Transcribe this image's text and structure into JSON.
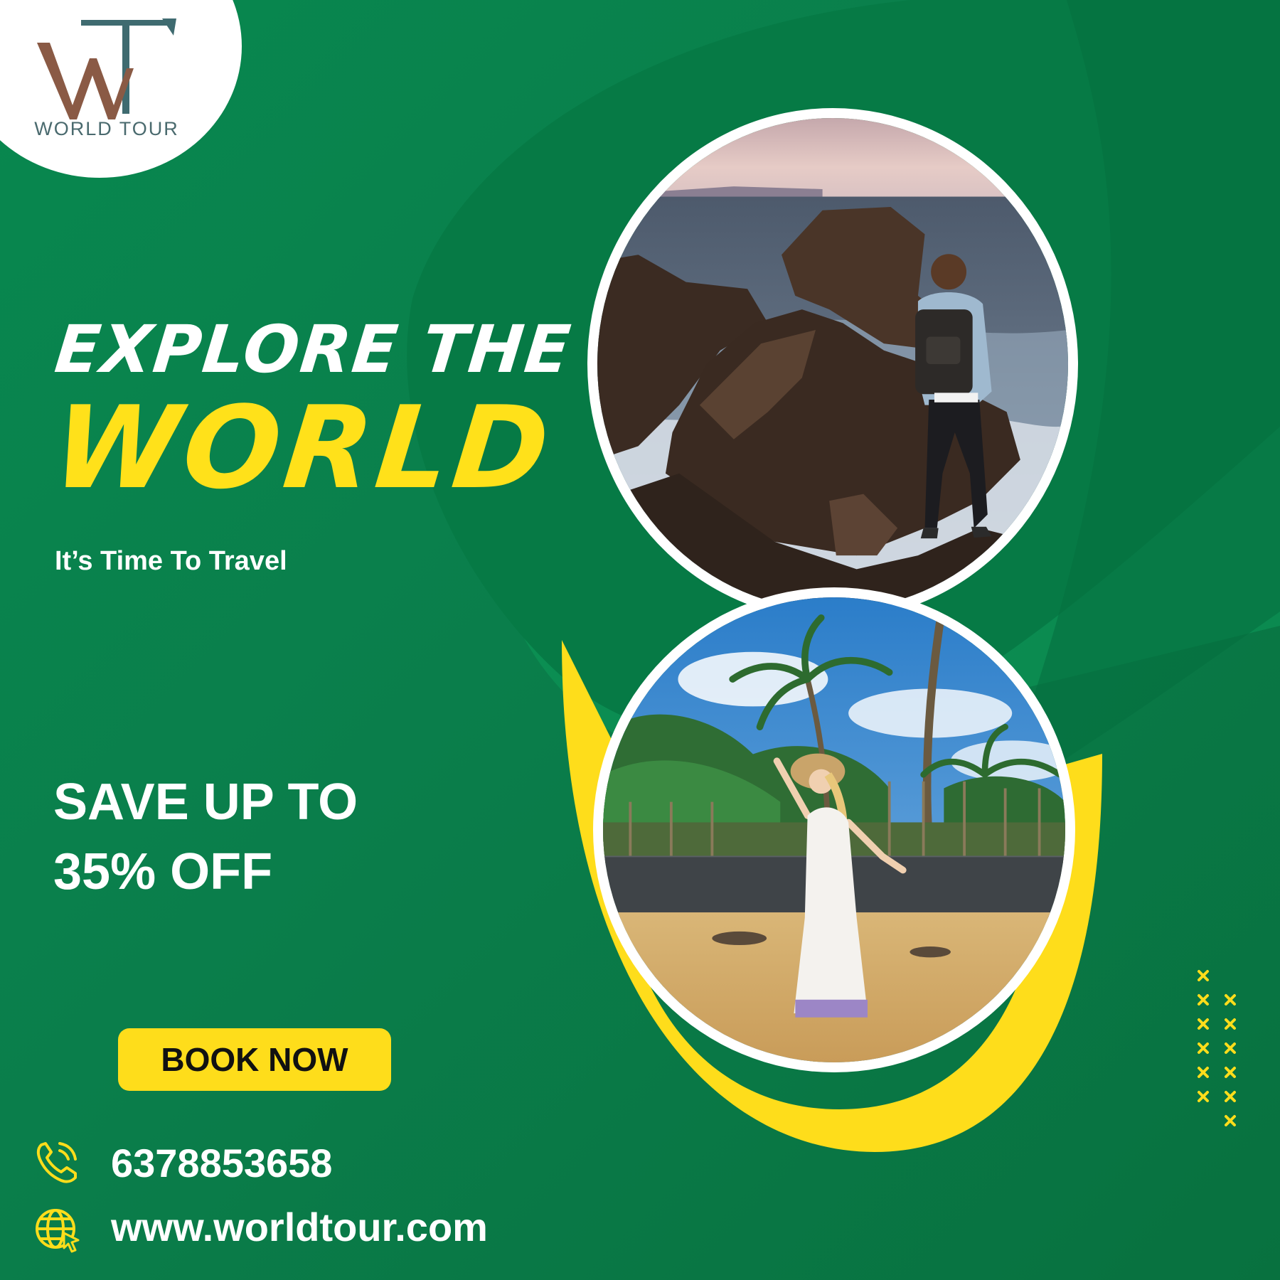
{
  "brand": {
    "logo_letters": "WT",
    "name": "WORLD TOUR"
  },
  "headline": {
    "line1": "EXPLORE THE",
    "line2": "WORLD",
    "tagline": "It’s Time To Travel"
  },
  "offer": {
    "line1": "SAVE UP TO",
    "line2": "35% OFF"
  },
  "cta": {
    "label": "BOOK NOW"
  },
  "contact": {
    "phone": "6378853658",
    "website": "www.worldtour.com",
    "phone_icon": "phone-icon",
    "globe_icon": "globe-icon"
  },
  "colors": {
    "brand_green": "#0a8a50",
    "accent_yellow": "#fedd1b",
    "logo_brown": "#8a5a45",
    "logo_teal": "#3f6b70"
  }
}
